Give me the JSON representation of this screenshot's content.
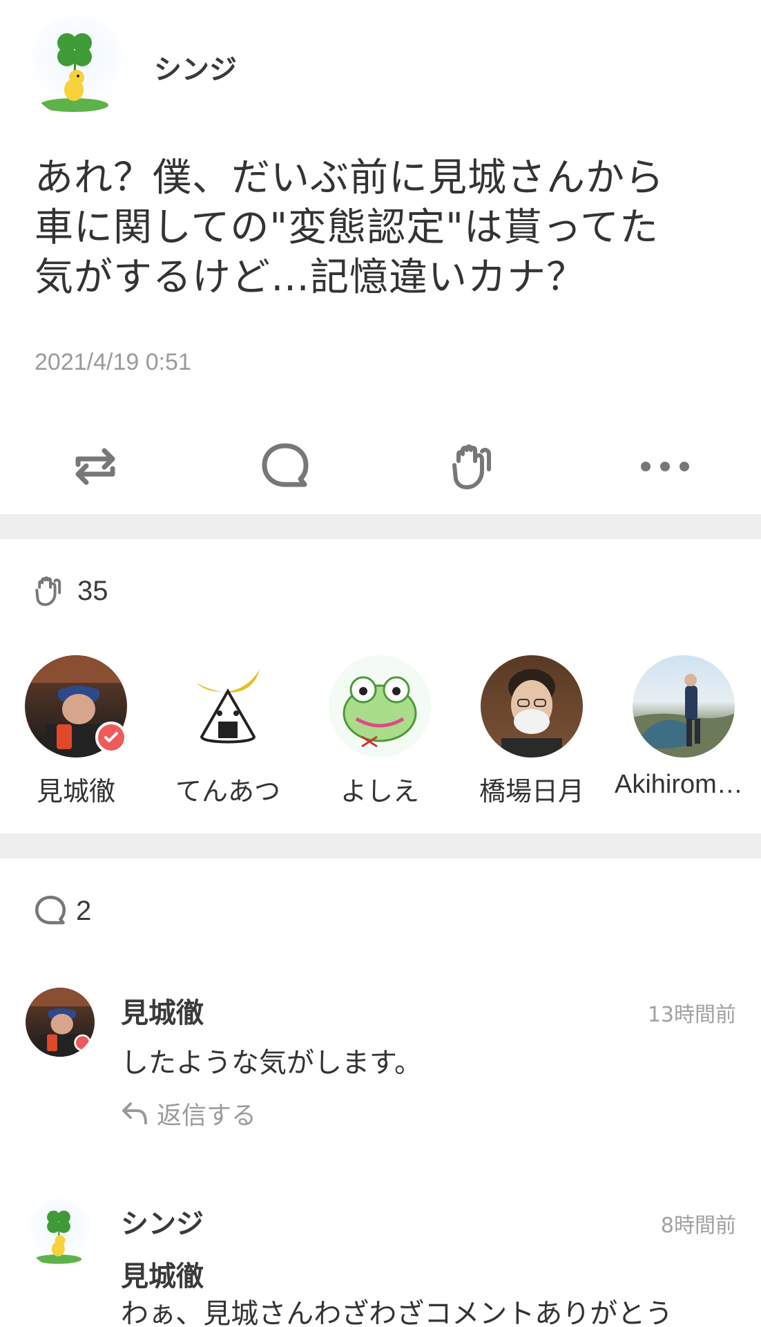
{
  "post": {
    "author": "シンジ",
    "body_lines": [
      "あれ？僕、だいぶ前に見城さんから",
      "車に関しての\"変態認定\"は貰ってた",
      "気がするけど…記憶違いカナ？"
    ],
    "timestamp": "2021/4/19 0:51"
  },
  "actions": [
    {
      "name": "repost-icon"
    },
    {
      "name": "comment-icon"
    },
    {
      "name": "clap-icon"
    },
    {
      "name": "more-icon"
    }
  ],
  "claps": {
    "count": "35",
    "users": [
      {
        "name": "見城徹",
        "verified": true
      },
      {
        "name": "てんあつ",
        "verified": false
      },
      {
        "name": "よしえ",
        "verified": false
      },
      {
        "name": "橋場日月",
        "verified": false
      },
      {
        "name": "Akihiroma…",
        "verified": false
      }
    ]
  },
  "comments": {
    "count": "2",
    "items": [
      {
        "author": "見城徹",
        "time": "13時間前",
        "text": "したような気がします。",
        "reply_label": "返信する"
      },
      {
        "author": "シンジ",
        "time": "8時間前",
        "mention": "見城徹",
        "text": "わぁ、見城さんわざわざコメントありがとう"
      }
    ]
  },
  "colors": {
    "badge": "#ef5a5a",
    "divider": "#eeeeee",
    "icon": "#777777"
  }
}
